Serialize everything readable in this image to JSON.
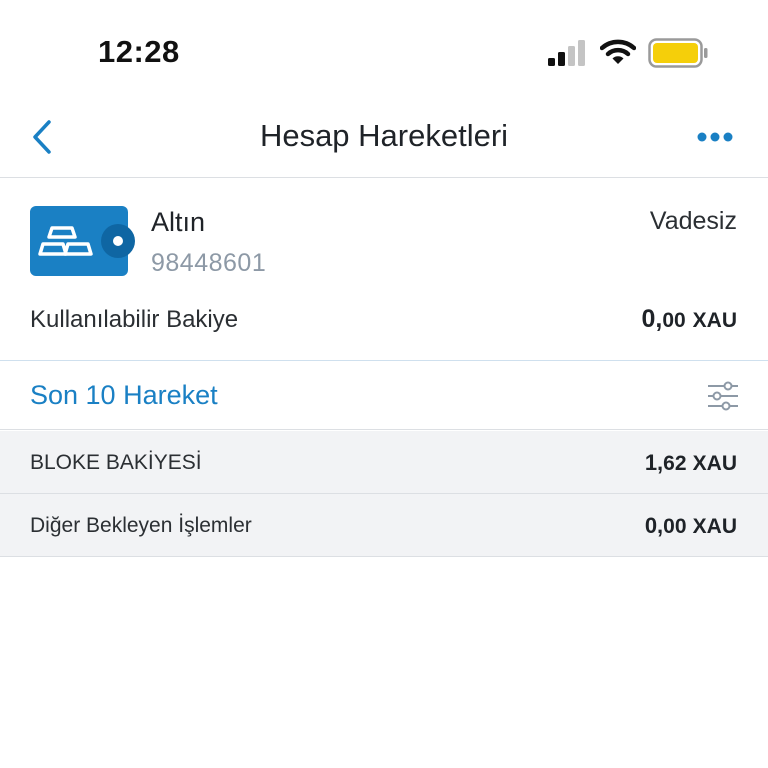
{
  "status_bar": {
    "time": "12:28",
    "icons": [
      "signal-icon",
      "wifi-icon",
      "battery-icon"
    ],
    "battery_color": "#f5cf0a"
  },
  "nav": {
    "title": "Hesap Hareketleri",
    "back_icon": "chevron-left-icon",
    "more_icon": "ellipsis-icon",
    "accent_color": "#1a80c4"
  },
  "account": {
    "name": "Altın",
    "number": "98448601",
    "type": "Vadesiz",
    "logo_icon": "gold-bars-wallet-icon",
    "logo_color": "#1a80c4",
    "balance_label": "Kullanılabilir Bakiye",
    "balance_int": "0,",
    "balance_dec": "00",
    "balance_unit": "XAU"
  },
  "section": {
    "title": "Son 10 Hareket",
    "filter_icon": "filter-sliders-icon"
  },
  "rows": [
    {
      "label": "BLOKE BAKİYESİ",
      "int": "1,",
      "dec": "62",
      "unit": "XAU"
    },
    {
      "label": "Diğer Bekleyen İşlemler",
      "int": "0,",
      "dec": "00",
      "unit": "XAU"
    }
  ]
}
